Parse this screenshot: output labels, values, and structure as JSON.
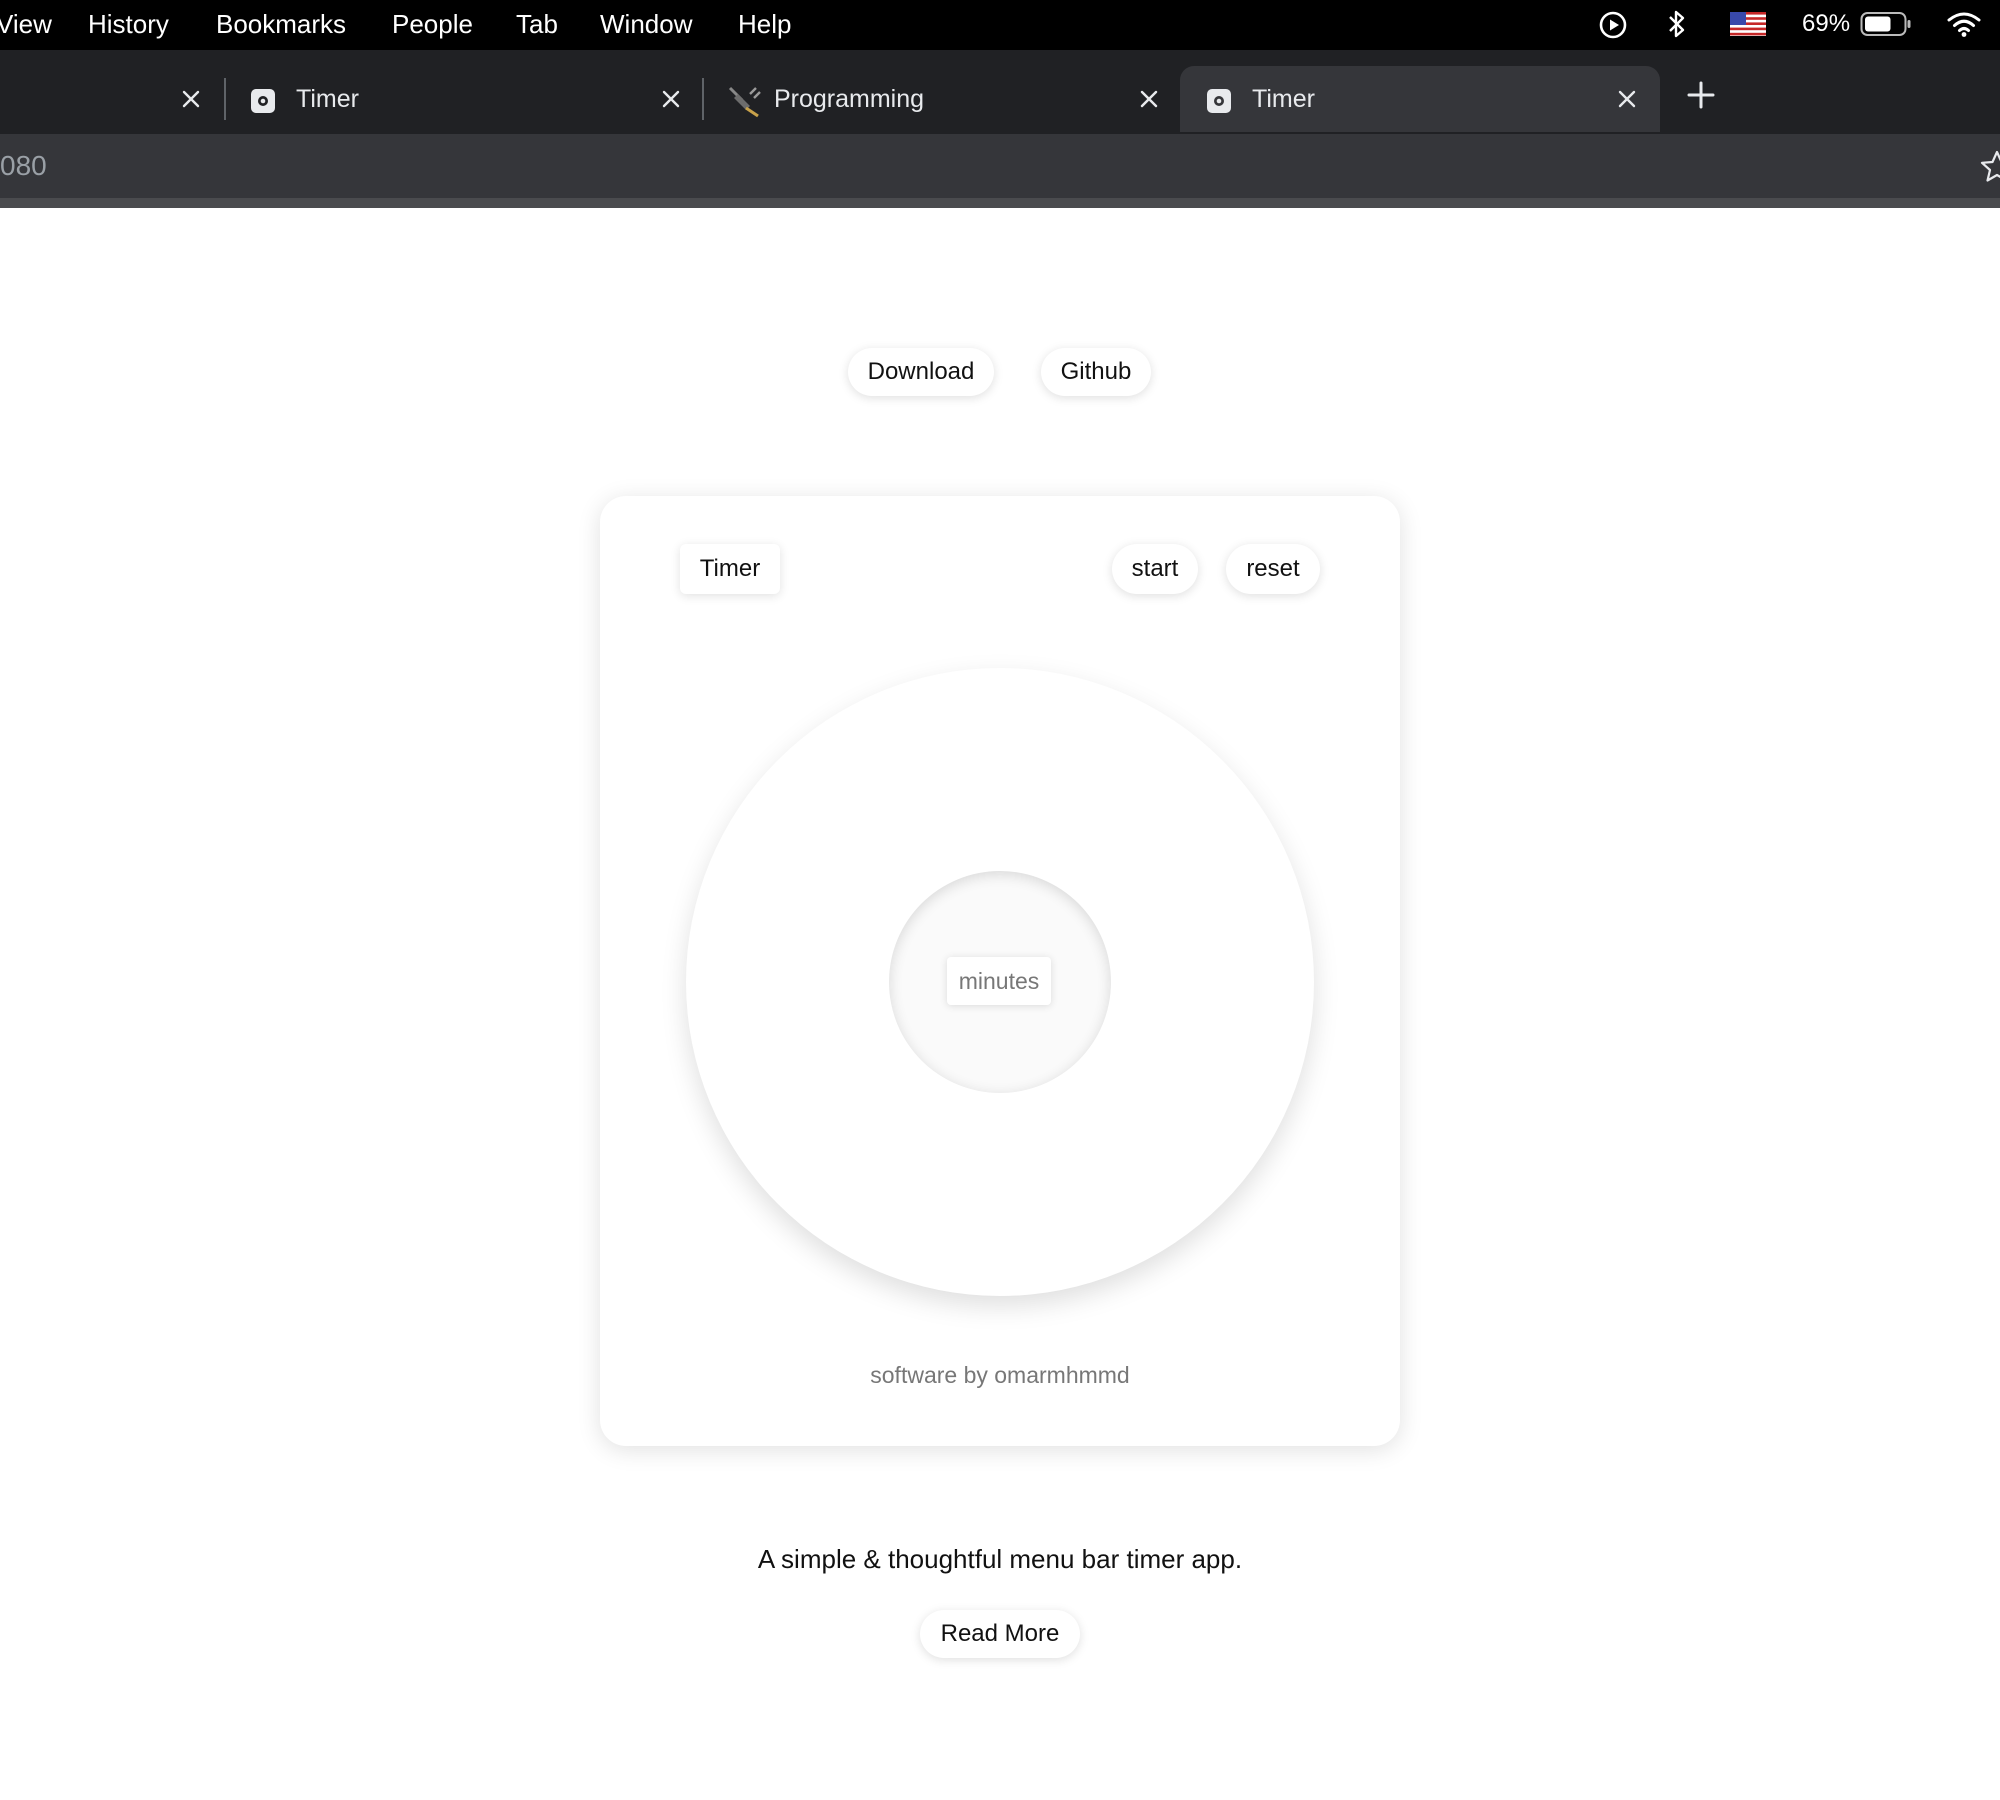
{
  "menubar": {
    "items": [
      "View",
      "History",
      "Bookmarks",
      "People",
      "Tab",
      "Window",
      "Help"
    ],
    "battery_percent": "69%",
    "battery_level": 0.69,
    "icons": [
      "play-circle-icon",
      "bluetooth-icon",
      "us-flag-icon",
      "battery-icon",
      "wifi-icon"
    ]
  },
  "browser": {
    "tabs": [
      {
        "title": "",
        "active": false
      },
      {
        "title": "Timer",
        "active": false,
        "favicon": "timer-favicon"
      },
      {
        "title": "Programming",
        "active": false,
        "favicon": "programming-favicon"
      },
      {
        "title": "Timer",
        "active": true,
        "favicon": "timer-favicon"
      }
    ],
    "url_fragment": "080",
    "theme": {
      "tabstrip": "#202124",
      "active_tab": "#35363a",
      "text": "#e8eaed"
    }
  },
  "page": {
    "nav": {
      "download_label": "Download",
      "github_label": "Github"
    },
    "timer_card": {
      "title": "Timer",
      "start_label": "start",
      "reset_label": "reset",
      "minutes_placeholder": "minutes",
      "credit": "software by omarmhmmd"
    },
    "tagline": "A simple & thoughtful menu bar timer app.",
    "read_more_label": "Read More"
  }
}
